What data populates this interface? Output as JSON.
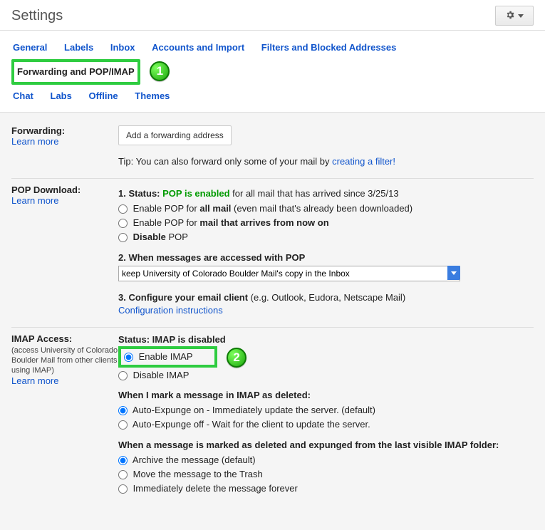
{
  "header": {
    "title": "Settings"
  },
  "tabs": {
    "row1": [
      "General",
      "Labels",
      "Inbox",
      "Accounts and Import",
      "Filters and Blocked Addresses",
      "Forwarding and POP/IMAP"
    ],
    "row2": [
      "Chat",
      "Labs",
      "Offline",
      "Themes"
    ],
    "active": "Forwarding and POP/IMAP"
  },
  "badges": {
    "one": "1",
    "two": "2"
  },
  "forwarding": {
    "label": "Forwarding:",
    "learn": "Learn more",
    "button": "Add a forwarding address",
    "tip_prefix": "Tip: You can also forward only some of your mail by ",
    "tip_link": "creating a filter!"
  },
  "pop": {
    "label": "POP Download:",
    "learn": "Learn more",
    "status_prefix": "1. Status: ",
    "status_value": "POP is enabled",
    "status_suffix": " for all mail that has arrived since 3/25/13",
    "opt1_pre": "Enable POP for ",
    "opt1_bold": "all mail",
    "opt1_post": " (even mail that's already been downloaded)",
    "opt2_pre": "Enable POP for ",
    "opt2_bold": "mail that arrives from now on",
    "opt3_bold": "Disable",
    "opt3_post": " POP",
    "accessed_heading": "2. When messages are accessed with POP",
    "select_value": "keep University of Colorado Boulder Mail's copy in the Inbox",
    "configure_prefix": "3. Configure your email client",
    "configure_suffix": " (e.g. Outlook, Eudora, Netscape Mail)",
    "configure_link": "Configuration instructions"
  },
  "imap": {
    "label": "IMAP Access:",
    "sub": "(access University of Colorado Boulder Mail from other clients using IMAP)",
    "learn": "Learn more",
    "status": "Status: IMAP is disabled",
    "enable": "Enable IMAP",
    "disable": "Disable IMAP",
    "mark_heading": "When I mark a message in IMAP as deleted:",
    "auto_on": "Auto-Expunge on - Immediately update the server. (default)",
    "auto_off": "Auto-Expunge off - Wait for the client to update the server.",
    "expunge_heading": "When a message is marked as deleted and expunged from the last visible IMAP folder:",
    "exp1": "Archive the message (default)",
    "exp2": "Move the message to the Trash",
    "exp3": "Immediately delete the message forever"
  }
}
